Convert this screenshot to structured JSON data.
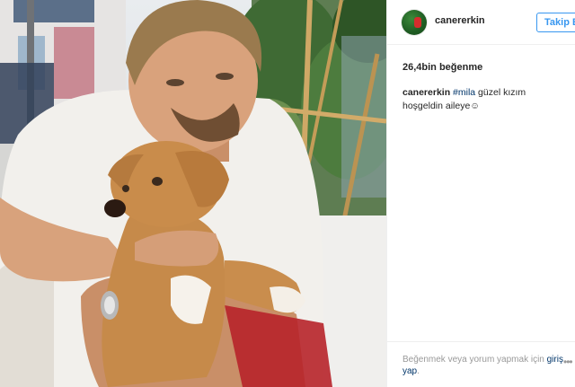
{
  "post": {
    "username": "canererkin",
    "follow_label": "Takip Et",
    "likes": "26,4bin beğenme",
    "caption": {
      "user": "canererkin",
      "hashtag": "#mila",
      "text": " güzel kızım hoşgeldin aileye☺"
    },
    "login_prompt": "Beğenmek veya yorum yapmak için ",
    "login_link": "giriş yap",
    "login_suffix": "."
  },
  "colors": {
    "accent": "#3897f0",
    "link": "#003569",
    "muted": "#999999"
  },
  "icons": [
    "avatar",
    "more-options-icon"
  ]
}
